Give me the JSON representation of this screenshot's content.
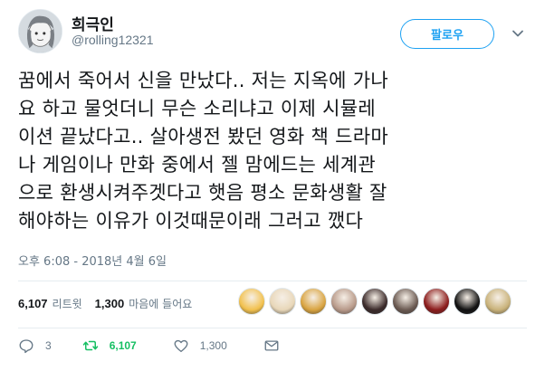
{
  "user": {
    "display_name": "희극인",
    "handle": "@rolling12321"
  },
  "follow_button": {
    "label": "팔로우"
  },
  "tweet": {
    "lines": [
      "꿈에서 죽어서 신을 만났다.. 저는 지옥에 가나",
      "요 하고 물엇더니 무슨 소리냐고 이제 시뮬레",
      "이션 끝났다고.. 살아생전 봤던 영화 책 드라마",
      "나 게임이나 만화 중에서 젤 맘에드는 세계관",
      "으로 환생시켜주겟다고 햇음 평소 문화생활 잘",
      "해야하는 이유가 이것때문이래 그러고 깼다"
    ],
    "timestamp": "오후 6:08 - 2018년 4월 6일"
  },
  "stats": {
    "retweets_count": "6,107",
    "retweets_label": "리트윗",
    "likes_count": "1,300",
    "likes_label": "마음에 들어요"
  },
  "likers": [
    {
      "icon": "liker-avatar",
      "color": "#f2c14e"
    },
    {
      "icon": "liker-avatar",
      "color": "#e8d7b9"
    },
    {
      "icon": "liker-avatar",
      "color": "#d9a441"
    },
    {
      "icon": "liker-avatar",
      "color": "#b89a8a"
    },
    {
      "icon": "liker-avatar",
      "color": "#3b2a2a"
    },
    {
      "icon": "liker-avatar",
      "color": "#6b5a52"
    },
    {
      "icon": "liker-avatar",
      "color": "#8c1c1c"
    },
    {
      "icon": "liker-avatar",
      "color": "#111111"
    },
    {
      "icon": "liker-avatar",
      "color": "#c9b27a"
    }
  ],
  "actions": {
    "reply_count": "3",
    "retweet_count": "6,107",
    "like_count": "1,300"
  },
  "colors": {
    "accent": "#1da1f2",
    "retweet_active": "#17bf63",
    "muted": "#657786"
  }
}
